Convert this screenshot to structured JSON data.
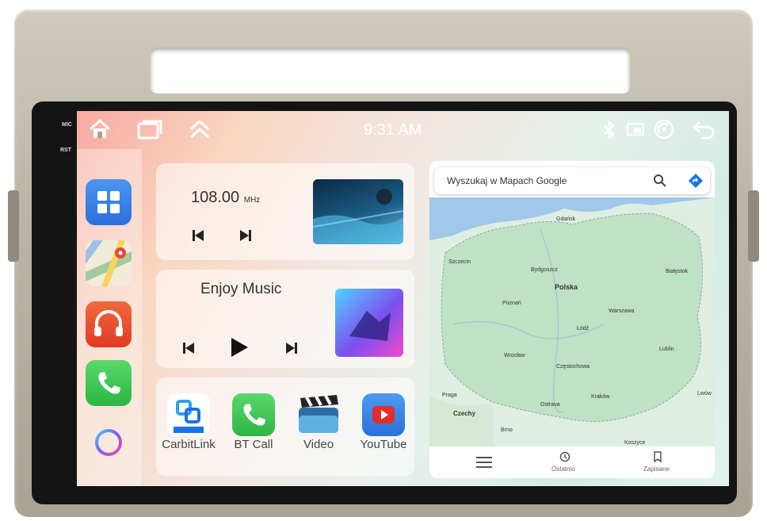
{
  "statusbar": {
    "time": "9:31 AM",
    "icons": [
      "home-icon",
      "recent-apps-icon",
      "expand-up-icon",
      "bluetooth-icon",
      "screen-mirror-icon",
      "wifi-icon",
      "back-icon"
    ]
  },
  "hardware": {
    "mic_label": "MIC",
    "rst_label": "RST"
  },
  "dock": {
    "apps": [
      "app-grid-icon",
      "maps-icon",
      "headphones-icon",
      "phone-icon",
      "assistant-ring-icon"
    ]
  },
  "radio": {
    "frequency": "108.00",
    "unit": "MHz"
  },
  "music": {
    "title": "Enjoy Music"
  },
  "apps": [
    {
      "label": "CarbitLink",
      "badge": "CarbitLink",
      "icon": "carbitlink-icon"
    },
    {
      "label": "BT Call",
      "icon": "bt-call-icon"
    },
    {
      "label": "Video",
      "icon": "video-icon"
    },
    {
      "label": "YouTube",
      "icon": "youtube-icon"
    }
  ],
  "map": {
    "search_placeholder": "Wyszukaj w Mapach Google",
    "labels": {
      "gdansk": "Gdańsk",
      "szczecin": "Szczecin",
      "bydgoszcz": "Bydgoszcz",
      "polska": "Polska",
      "bialystok": "Białystok",
      "poznan": "Poznań",
      "warszawa": "Warszawa",
      "lodz": "Łódź",
      "lublin": "Lublin",
      "wroclaw": "Wrocław",
      "czestochowa": "Częstochowa",
      "praga": "Praga",
      "ostrava": "Ostrava",
      "krakow": "Kraków",
      "czechy": "Czechy",
      "koszyce": "Koszyce",
      "lwow": "Lwów",
      "brno": "Brno"
    },
    "nav": {
      "recent": "Ostatnio",
      "saved": "Zapisane"
    }
  },
  "colors": {
    "accent": "#1a73e8",
    "dock_blue": "#3c86e8",
    "dock_red": "#e5532f",
    "dock_green": "#3cc653",
    "youtube_red": "#e52d27"
  }
}
